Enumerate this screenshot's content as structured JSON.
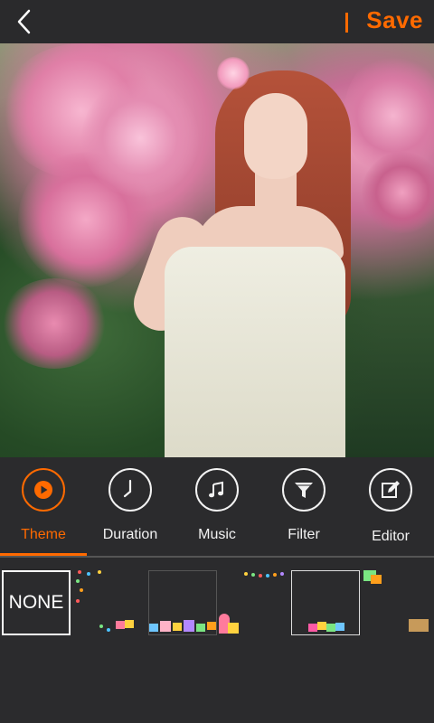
{
  "header": {
    "save_label": "Save"
  },
  "tabs": [
    {
      "label": "Theme",
      "icon": "play-icon",
      "active": true
    },
    {
      "label": "Duration",
      "icon": "clock-icon",
      "active": false
    },
    {
      "label": "Music",
      "icon": "music-note-icon",
      "active": false
    },
    {
      "label": "Filter",
      "icon": "funnel-icon",
      "active": false
    },
    {
      "label": "Editor",
      "icon": "edit-icon",
      "active": false
    }
  ],
  "themes": {
    "none_label": "NONE"
  },
  "colors": {
    "accent": "#ff6a00",
    "background": "#2b2b2d",
    "text": "#f2f2f2"
  }
}
